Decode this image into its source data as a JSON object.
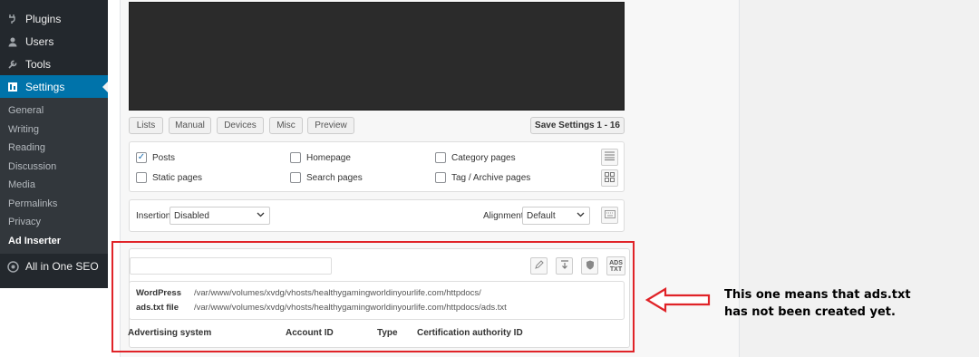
{
  "sidebar": {
    "menu": [
      {
        "label": "Plugins",
        "icon": "plugin-icon"
      },
      {
        "label": "Users",
        "icon": "users-icon"
      },
      {
        "label": "Tools",
        "icon": "wrench-icon"
      },
      {
        "label": "Settings",
        "icon": "settings-icon",
        "active": true
      }
    ],
    "submenu": [
      "General",
      "Writing",
      "Reading",
      "Discussion",
      "Media",
      "Permalinks",
      "Privacy",
      "Ad Inserter"
    ],
    "current_submenu": "Ad Inserter",
    "aioseo": {
      "label": "All in One SEO",
      "icon": "aioseo-icon"
    }
  },
  "tabs": [
    "Lists",
    "Manual",
    "Devices",
    "Misc",
    "Preview"
  ],
  "save_button": "Save Settings 1 - 16",
  "checkboxes": [
    {
      "label": "Posts",
      "checked": true
    },
    {
      "label": "Homepage",
      "checked": false
    },
    {
      "label": "Category pages",
      "checked": false
    },
    {
      "label": "Static pages",
      "checked": false
    },
    {
      "label": "Search pages",
      "checked": false
    },
    {
      "label": "Tag / Archive pages",
      "checked": false
    }
  ],
  "insertion": {
    "label": "Insertion",
    "value": "Disabled"
  },
  "alignment": {
    "label": "Alignment",
    "value": "Default"
  },
  "ads_txt": {
    "button_label": "ADS TXT",
    "wordpress_label": "WordPress",
    "wordpress_path": "/var/www/volumes/xvdg/vhosts/healthygamingworldinyourlife.com/httpdocs/",
    "file_label": "ads.txt file",
    "file_path": "/var/www/volumes/xvdg/vhosts/healthygamingworldinyourlife.com/httpdocs/ads.txt",
    "columns": [
      "Advertising system",
      "Account ID",
      "Type",
      "Certification authority ID"
    ]
  },
  "annotation": {
    "line1": "This one means that ads.txt",
    "line2": "has not been created yet."
  },
  "colors": {
    "highlight": "#e02328",
    "admin_blue": "#0073aa",
    "sidebar": "#23282d"
  }
}
